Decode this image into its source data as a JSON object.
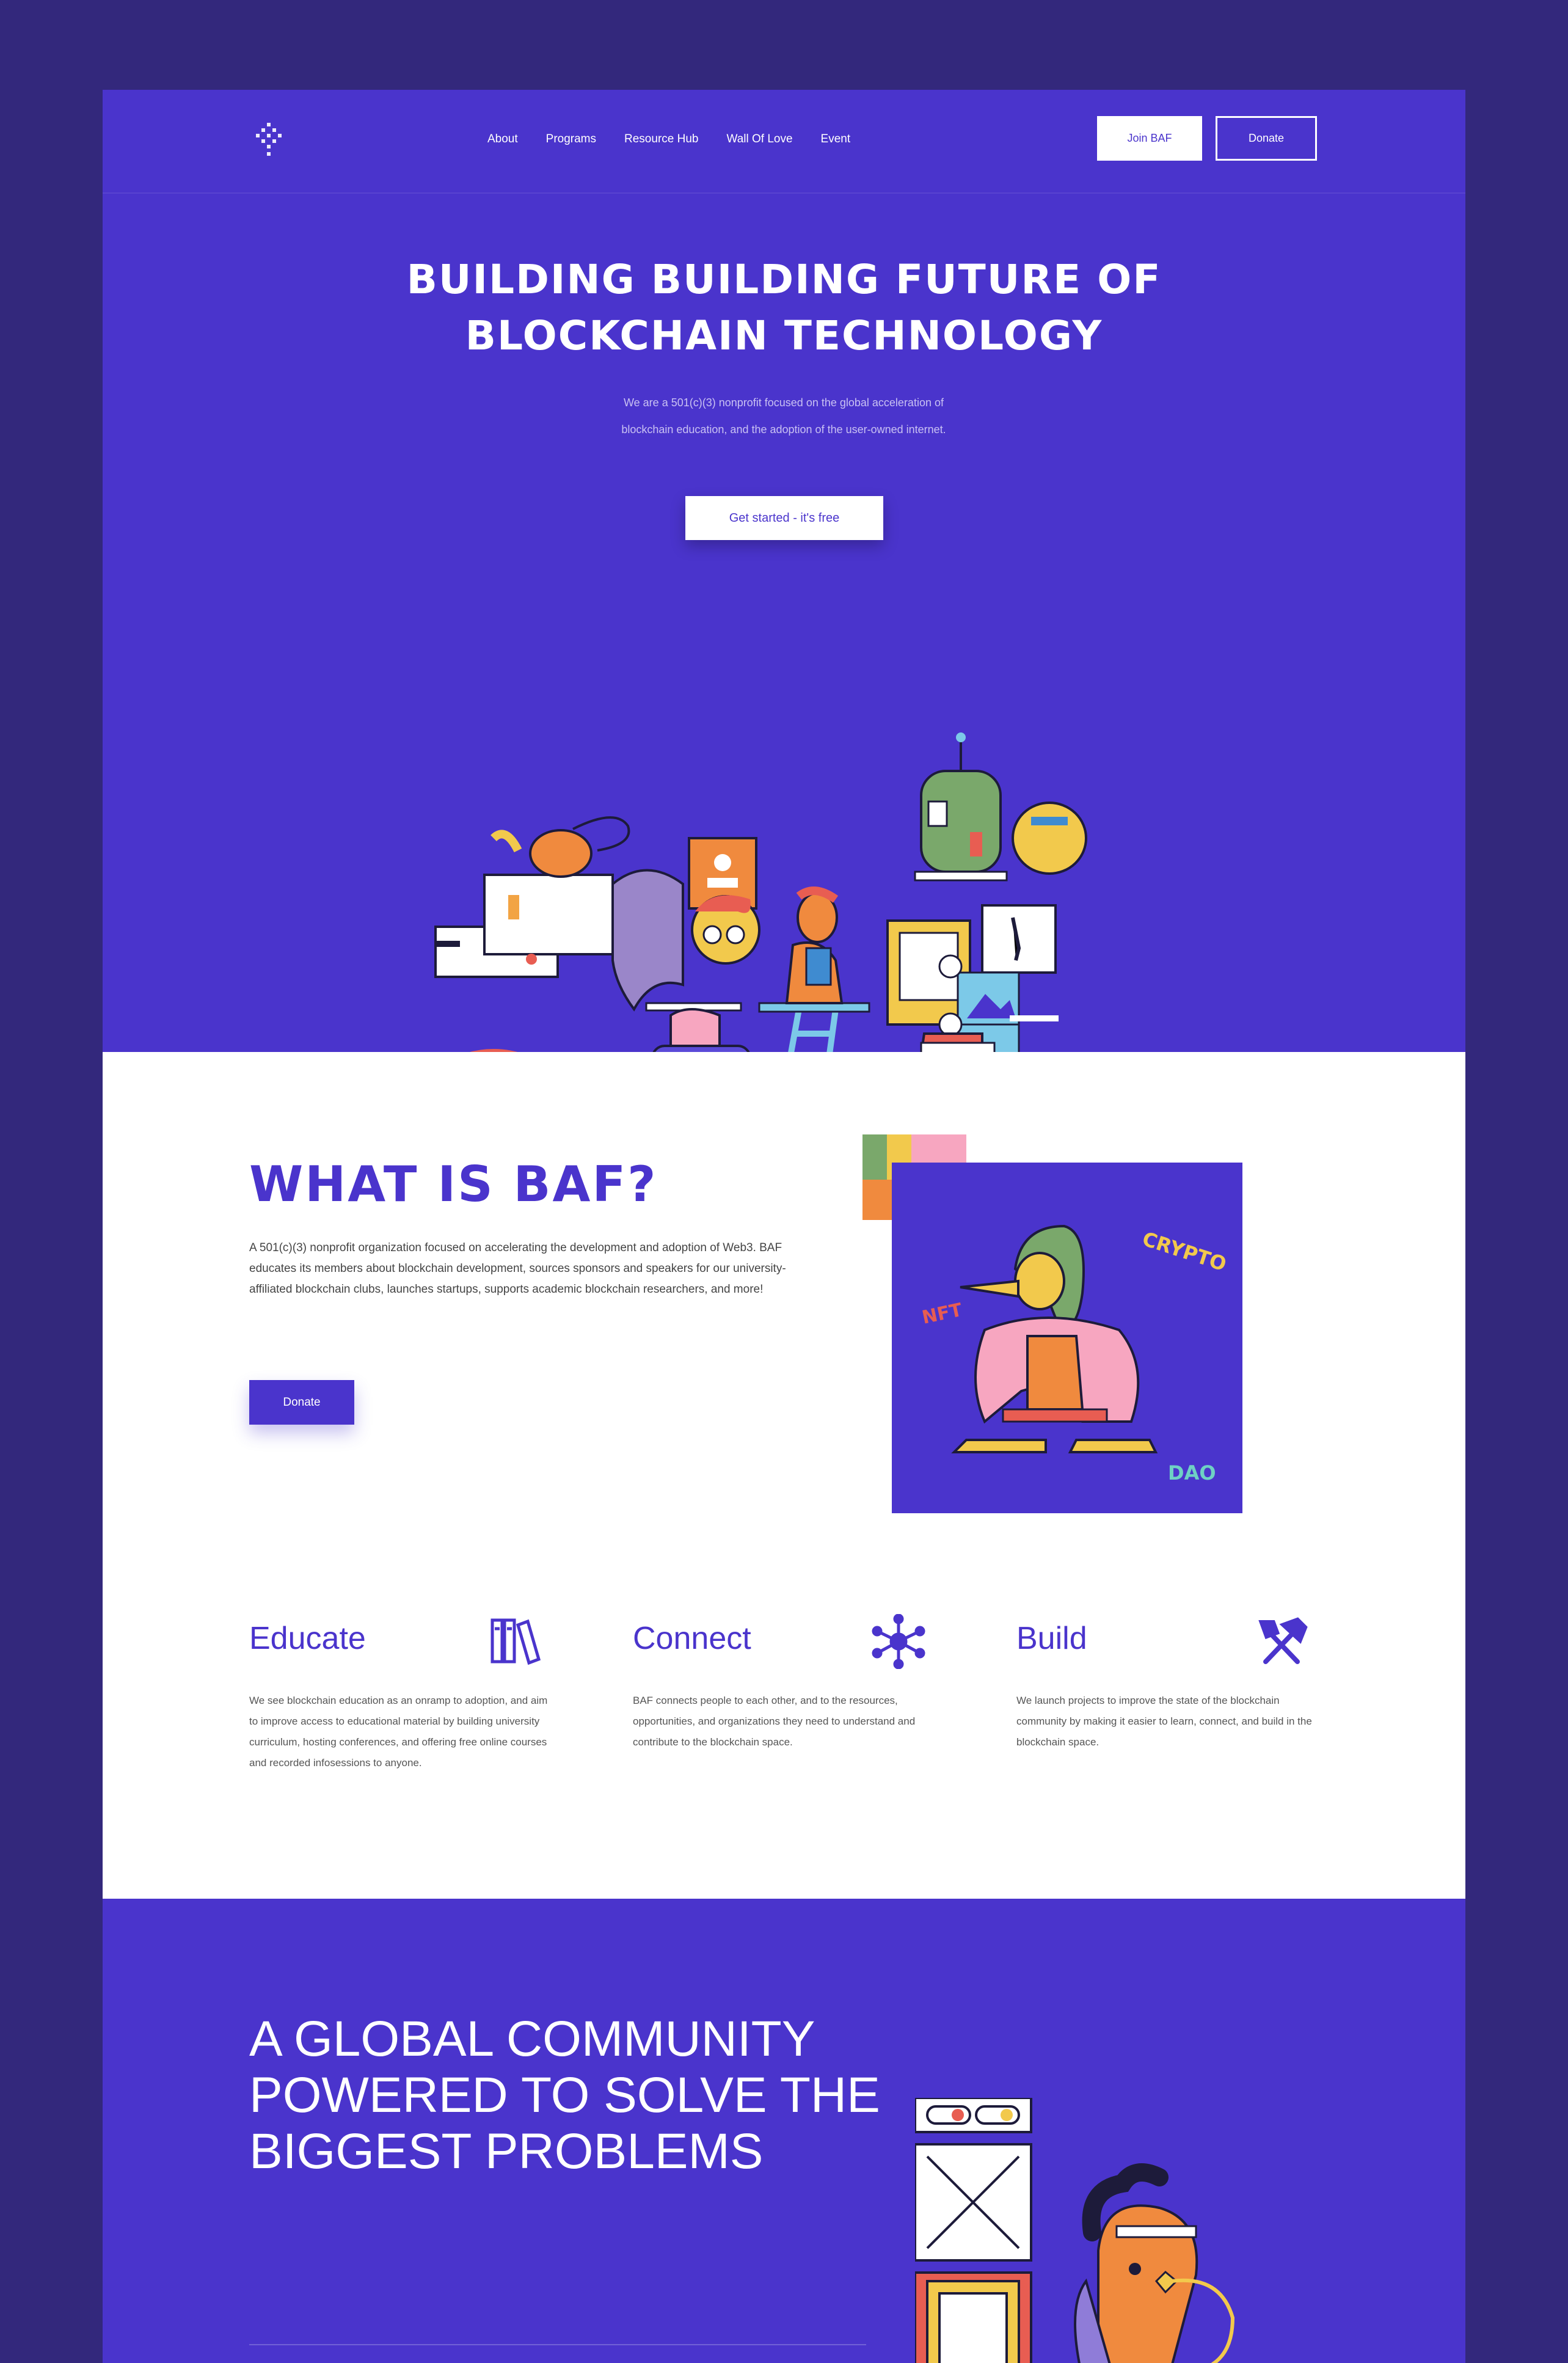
{
  "nav": {
    "links": [
      "About",
      "Programs",
      "Resource Hub",
      "Wall Of Love",
      "Event"
    ],
    "join_label": "Join BAF",
    "donate_label": "Donate"
  },
  "hero": {
    "title_line1": "BUILDING BUILDING FUTURE OF",
    "title_line2": "BLOCKCHAIN TECHNOLOGY",
    "subtitle": "We are a 501(c)(3) nonprofit focused on the global acceleration of blockchain education, and the adoption of the user-owned internet.",
    "cta_label": "Get started - it's free"
  },
  "what": {
    "title": "WHAT IS BAF?",
    "body": "A 501(c)(3) nonprofit organization focused on accelerating the development and adoption of Web3. BAF educates its members about blockchain development, sources sponsors and speakers for our university-affiliated blockchain clubs, launches startups, supports academic blockchain researchers, and more!",
    "donate_label": "Donate",
    "art_words": [
      "CRYPTO",
      "NFT",
      "DAO"
    ]
  },
  "pillars": [
    {
      "title": "Educate",
      "icon": "books-icon",
      "text": "We see blockchain education as an onramp to adoption, and aim to improve access to educational material by building university curriculum, hosting conferences, and offering free online courses and recorded infosessions to anyone."
    },
    {
      "title": "Connect",
      "icon": "network-icon",
      "text": "BAF connects people to each other, and to the resources, opportunities, and organizations they need to understand and contribute to the blockchain space."
    },
    {
      "title": "Build",
      "icon": "tools-icon",
      "text": "We launch projects to improve the state of the blockchain community by making it easier to learn, connect, and build in the blockchain space."
    }
  ],
  "community": {
    "title": "A GLOBAL COMMUNITY POWERED TO SOLVE THE BIGGEST PROBLEMS"
  },
  "colors": {
    "brand": "#4a34cc",
    "page_bg": "#33287c",
    "white": "#ffffff"
  }
}
